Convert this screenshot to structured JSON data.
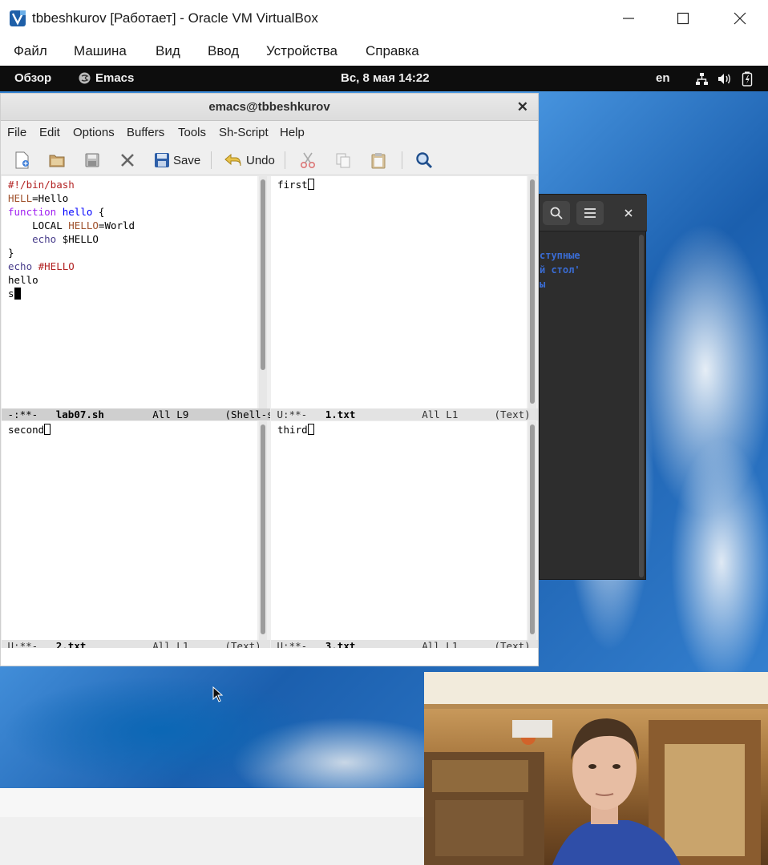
{
  "host": {
    "title": "tbbeshkurov [Работает] - Oracle VM VirtualBox",
    "menu": [
      "Файл",
      "Машина",
      "Вид",
      "Ввод",
      "Устройства",
      "Справка"
    ]
  },
  "gnome_bar": {
    "overview": "Обзор",
    "app": "Emacs",
    "clock": "Вс, 8 мая  14:22",
    "lang": "en"
  },
  "terminal": {
    "lines": [
      "ступные",
      "й стол'",
      "ы"
    ]
  },
  "emacs": {
    "title": "emacs@tbbeshkurov",
    "menu": [
      "File",
      "Edit",
      "Options",
      "Buffers",
      "Tools",
      "Sh-Script",
      "Help"
    ],
    "toolbar": {
      "save": "Save",
      "undo": "Undo"
    },
    "windows": {
      "top_left": {
        "modeline": {
          "status": "-:**-",
          "buffer": "lab07.sh",
          "pos": "All L9",
          "mode": "(Shell-s"
        }
      },
      "top_right": {
        "text": "first",
        "modeline": {
          "status": "U:**-",
          "buffer": "1.txt",
          "pos": "All L1",
          "mode": "(Text)"
        }
      },
      "bottom_left": {
        "text": "second",
        "modeline": {
          "status": "U:**-",
          "buffer": "2.txt",
          "pos": "All L1",
          "mode": "(Text)"
        }
      },
      "bottom_right": {
        "text": "third",
        "modeline": {
          "status": "U:**-",
          "buffer": "3.txt",
          "pos": "All L1",
          "mode": "(Text)"
        }
      }
    },
    "code": {
      "l1": "#!/bin/bash",
      "l2_var": "HELL",
      "l2_rest": "=Hello",
      "l3_kw": "function",
      "l3_fn": "hello",
      "l3_rest": " {",
      "l4_indent": "    ",
      "l4_kw": "LOCAL",
      "l4_var": "HELLO",
      "l4_rest": "=World",
      "l5_indent": "    ",
      "l5_bi": "echo",
      "l5_rest": " $HELLO",
      "l6": "}",
      "l7_bi": "echo",
      "l7_cm": " #HELLO",
      "l8": "hello",
      "l9": "s"
    }
  },
  "colors": {
    "accent": "#3a6cd3",
    "gnome_bar": "#0d0d0d"
  }
}
